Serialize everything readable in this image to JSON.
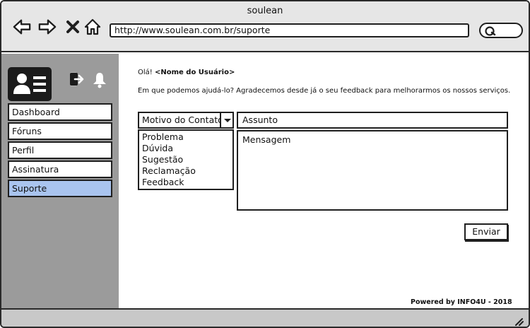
{
  "window": {
    "title": "soulean"
  },
  "browser": {
    "url": "http://www.soulean.com.br/suporte",
    "icons": [
      "arrow-left-icon",
      "arrow-right-icon",
      "close-icon",
      "home-icon",
      "search-icon"
    ]
  },
  "sidebar": {
    "icons": [
      "user-card-icon",
      "logout-icon",
      "bell-icon"
    ],
    "items": [
      {
        "label": "Dashboard",
        "active": false
      },
      {
        "label": "Fóruns",
        "active": false
      },
      {
        "label": "Perfil",
        "active": false
      },
      {
        "label": "Assinatura",
        "active": false
      },
      {
        "label": "Suporte",
        "active": true
      }
    ],
    "active_color": "#a9c4ef"
  },
  "main": {
    "greeting_prefix": "Olá!",
    "user_name": "<Nome do Usuário>",
    "question": "Em que podemos ajudá-lo? Agradecemos desde já o seu feedback para melhorarmos os nossos serviços.",
    "contact_select": {
      "value": "Motivo do Contato",
      "options": [
        "Problema",
        "Dúvida",
        "Sugestão",
        "Reclamação",
        "Feedback"
      ]
    },
    "subject_placeholder": "Assunto",
    "message_placeholder": "Mensagem",
    "send_label": "Enviar",
    "credit": "Powered by INFO4U - 2018"
  }
}
